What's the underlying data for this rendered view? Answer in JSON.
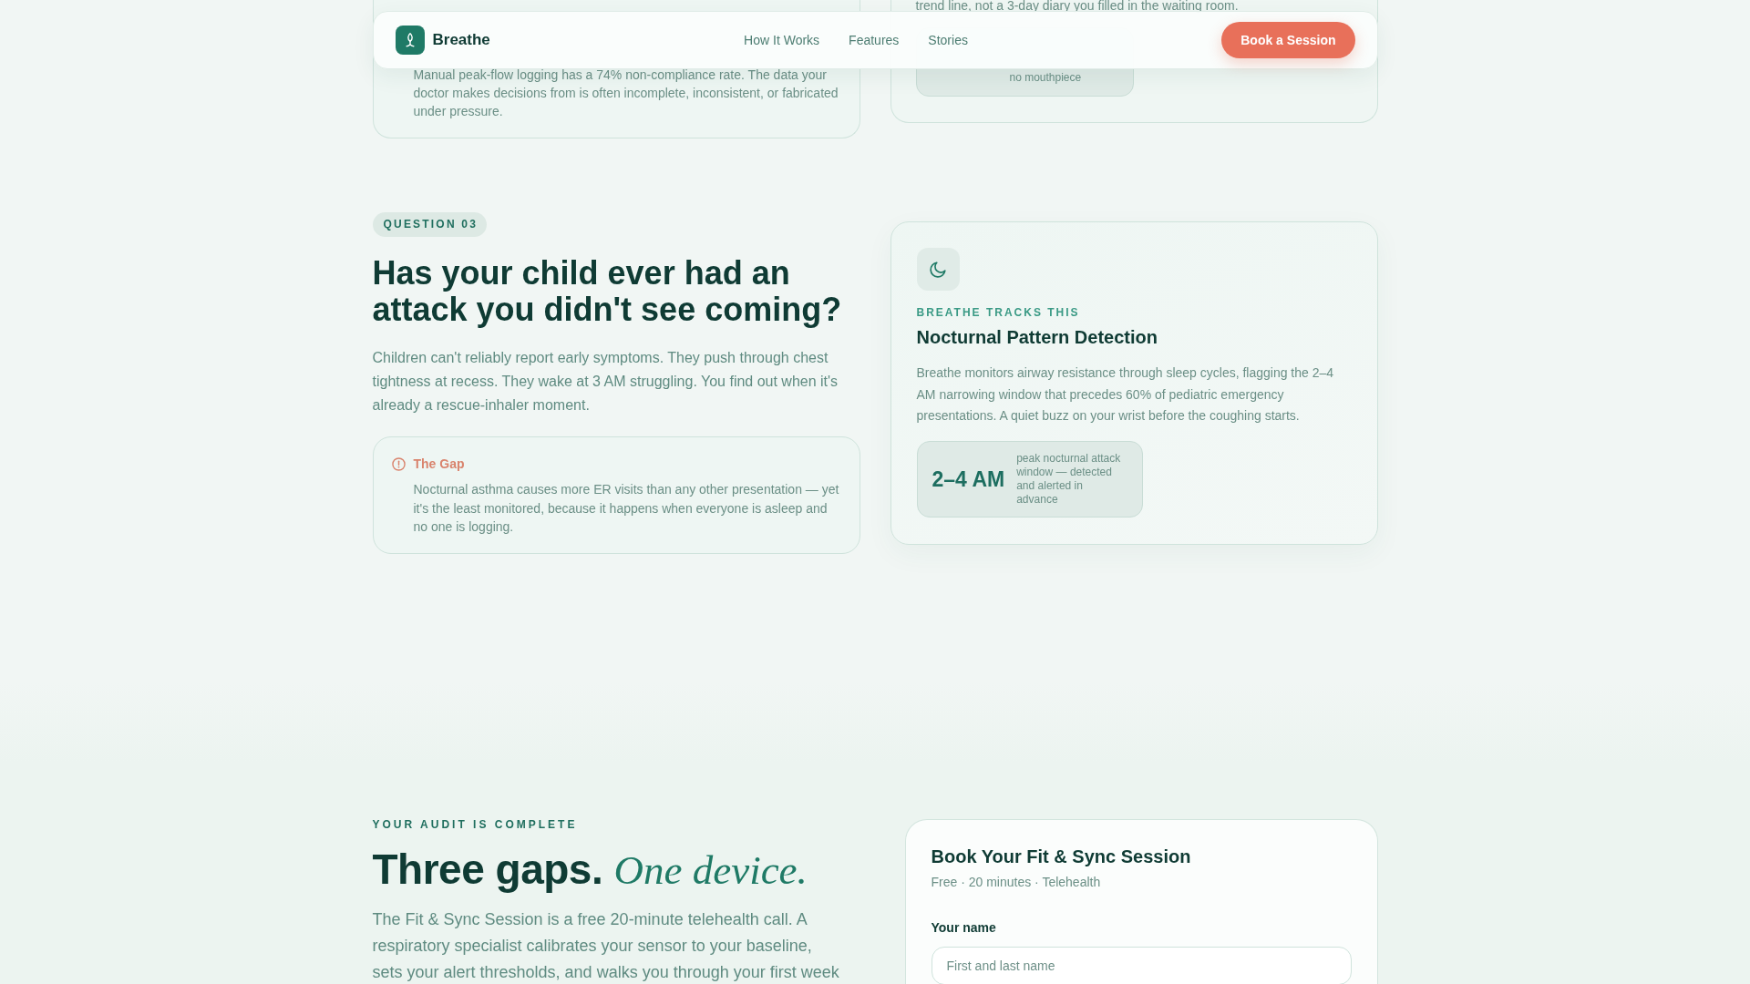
{
  "nav": {
    "brand": "Breathe",
    "links": [
      {
        "label": "How It Works"
      },
      {
        "label": "Features"
      },
      {
        "label": "Stories"
      }
    ],
    "cta": "Book a Session"
  },
  "previous_question": {
    "callout": {
      "text": "Manual peak-flow logging has a 74% non-compliance rate. The data your doctor makes decisions from is often incomplete, inconsistent, or fabricated under pressure."
    },
    "feature": {
      "text": "trend line, not a 3-day diary you filled in the waiting room.",
      "stat_caption": "no mouthpiece"
    }
  },
  "question": {
    "badge": "QUESTION 03",
    "heading": "Has your child ever had an attack you didn't see coming?",
    "body": "Children can't reliably report early symptoms. They push through chest tightness at recess. They wake at 3 AM struggling. You find out when it's already a rescue-inhaler moment.",
    "callout": {
      "title": "The Gap",
      "text": "Nocturnal asthma causes more ER visits than any other presentation — yet it's the least monitored, because it happens when everyone is asleep and no one is logging."
    },
    "feature": {
      "eyebrow": "BREATHE TRACKS THIS",
      "title": "Nocturnal Pattern Detection",
      "text": "Breathe monitors airway resistance through sleep cycles, flagging the 2–4 AM narrowing window that precedes 60% of pediatric emergency presentations. A quiet buzz on your wrist before the coughing starts.",
      "stat": {
        "value": "2–4 AM",
        "caption": "peak nocturnal attack window — detected and alerted in advance"
      }
    }
  },
  "audit": {
    "eyebrow": "YOUR AUDIT IS COMPLETE",
    "heading": "Three gaps. *One device.*",
    "body": "The Fit & Sync Session is a free 20-minute telehealth call. A respiratory specialist calibrates your sensor to your baseline, sets your alert thresholds, and walks you through your first week",
    "booking_form": {
      "title": "Book Your Fit & Sync Session",
      "meta": "Free · 20 minutes · Telehealth",
      "fields": [
        {
          "label": "Your name",
          "placeholder": "First and last name"
        }
      ]
    }
  }
}
